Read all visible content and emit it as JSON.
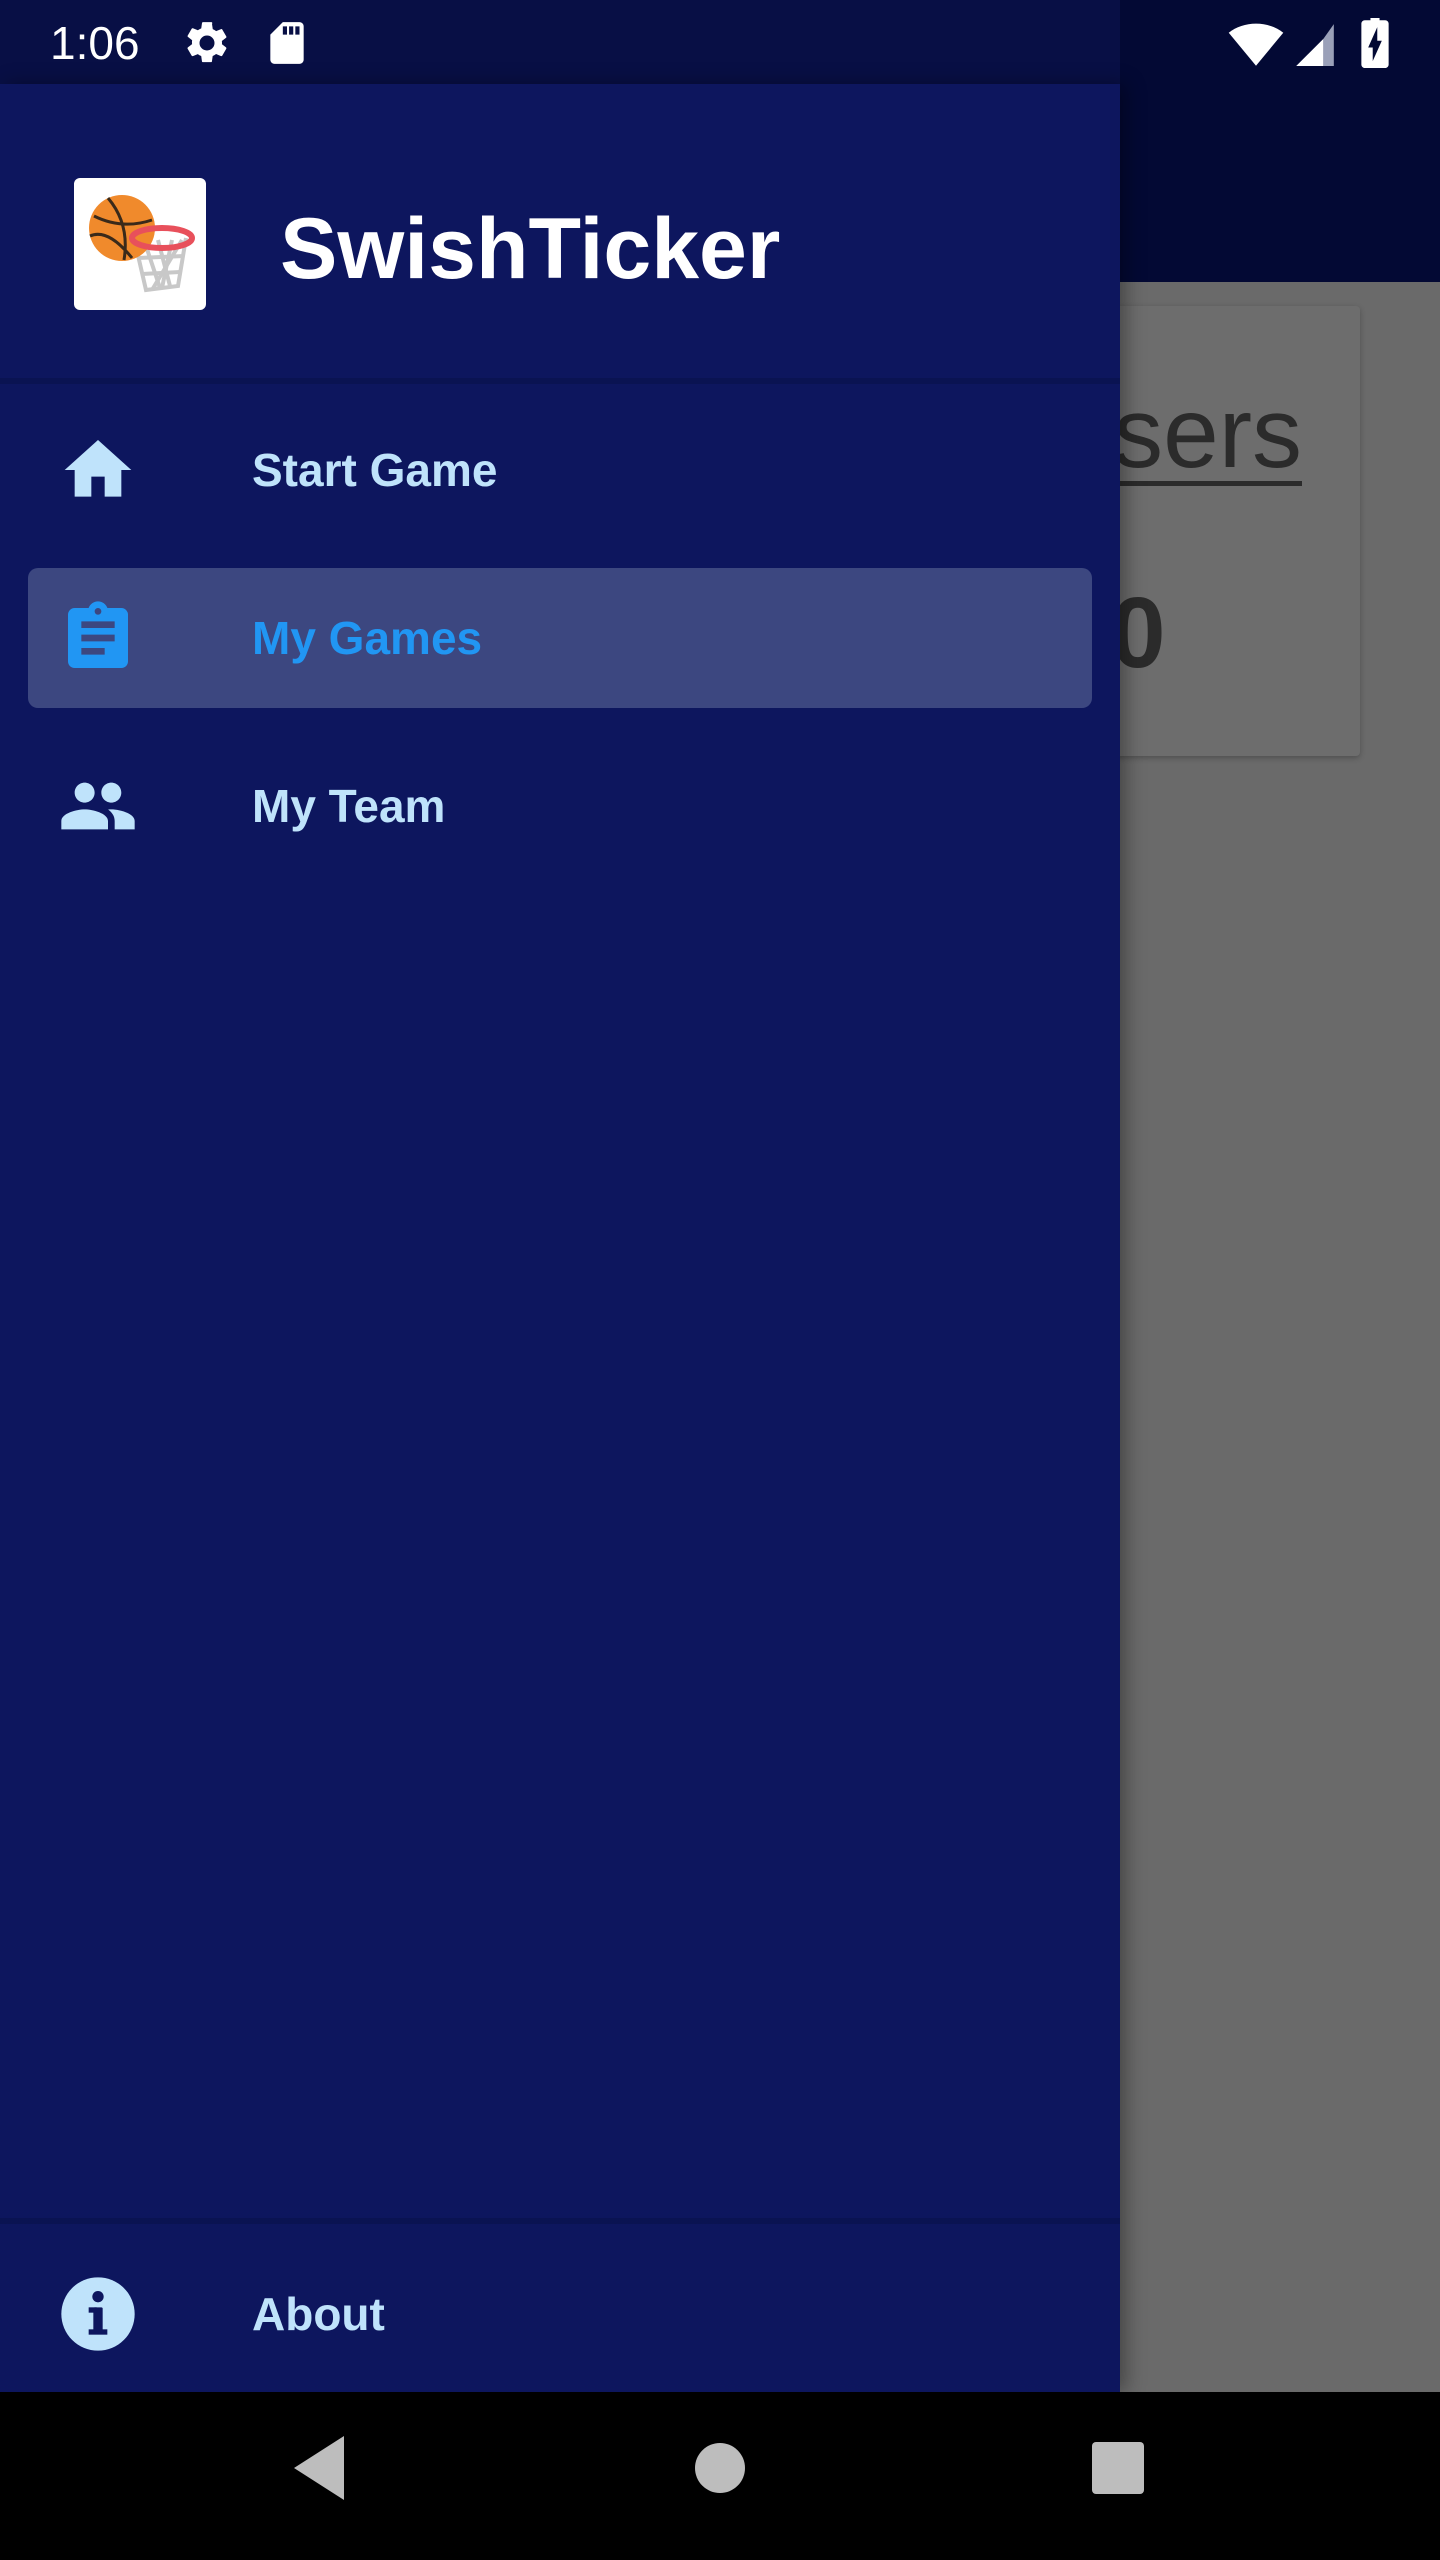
{
  "status_bar": {
    "time": "1:06"
  },
  "background": {
    "card_title": "sers",
    "card_value": "0"
  },
  "drawer": {
    "app_name": "SwishTicker",
    "items": [
      {
        "label": "Start Game",
        "icon": "home-icon"
      },
      {
        "label": "My Games",
        "icon": "clipboard-icon",
        "active": true
      },
      {
        "label": "My Team",
        "icon": "people-icon"
      }
    ],
    "footer_item": {
      "label": "About",
      "icon": "info-icon"
    }
  },
  "colors": {
    "drawer_bg": "#0d165e",
    "item_text": "#bfe3fb",
    "active_text": "#2196f3",
    "active_bg": "#3c4780"
  }
}
